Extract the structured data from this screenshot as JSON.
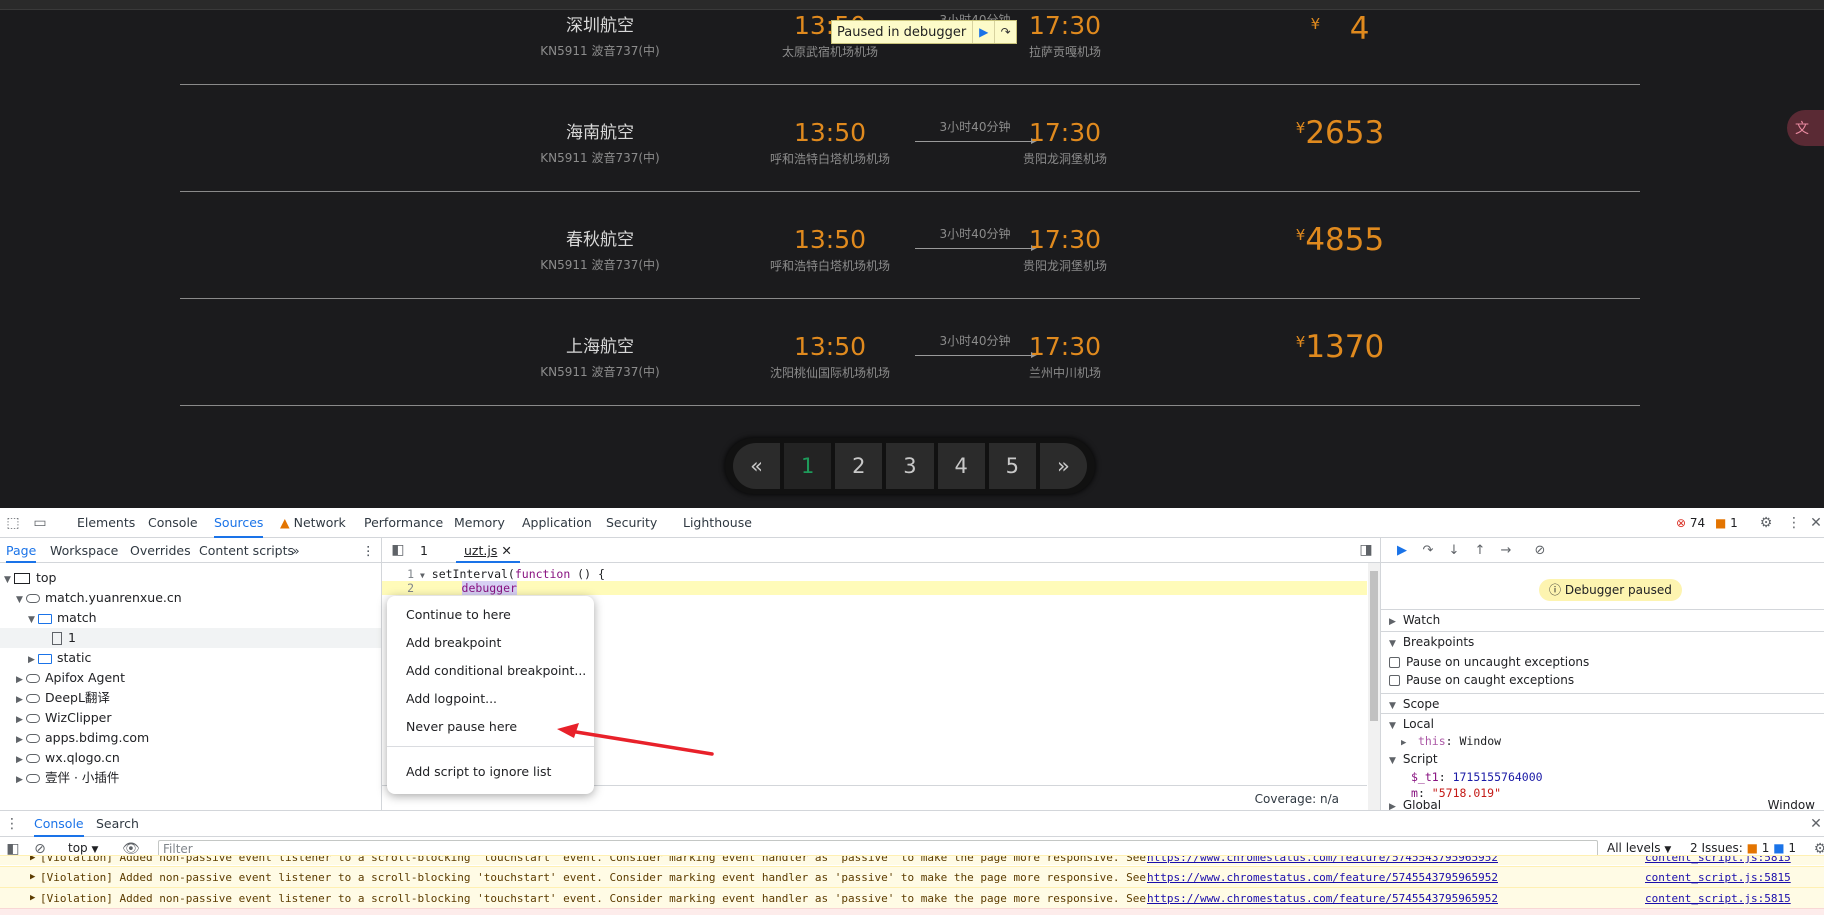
{
  "page": {
    "flights": [
      {
        "airline": "深圳航空",
        "plane": "KN5911 波音737(中)",
        "dep_time": "13:50",
        "dep_airport": "太原武宿机场机场",
        "duration": "3小时40分钟",
        "arr_time": "17:30",
        "arr_airport": "拉萨贡嘎机场",
        "currency": "¥",
        "price": "4"
      },
      {
        "airline": "海南航空",
        "plane": "KN5911 波音737(中)",
        "dep_time": "13:50",
        "dep_airport": "呼和浩特白塔机场机场",
        "duration": "3小时40分钟",
        "arr_time": "17:30",
        "arr_airport": "贵阳龙洞堡机场",
        "currency": "¥",
        "price": "2653"
      },
      {
        "airline": "春秋航空",
        "plane": "KN5911 波音737(中)",
        "dep_time": "13:50",
        "dep_airport": "呼和浩特白塔机场机场",
        "duration": "3小时40分钟",
        "arr_time": "17:30",
        "arr_airport": "贵阳龙洞堡机场",
        "currency": "¥",
        "price": "4855"
      },
      {
        "airline": "上海航空",
        "plane": "KN5911 波音737(中)",
        "dep_time": "13:50",
        "dep_airport": "沈阳桃仙国际机场机场",
        "duration": "3小时40分钟",
        "arr_time": "17:30",
        "arr_airport": "兰州中川机场",
        "currency": "¥",
        "price": "1370"
      }
    ],
    "paused_banner": "Paused in debugger",
    "pagination": {
      "prev": "«",
      "pages": [
        "1",
        "2",
        "3",
        "4",
        "5"
      ],
      "active": "1",
      "next": "»"
    },
    "colors": {
      "price": "#e08a1e",
      "active_page": "#1e9a5a",
      "background": "#1b1b1d"
    }
  },
  "devtools": {
    "tabs": [
      "Elements",
      "Console",
      "Sources",
      "Network",
      "Performance",
      "Memory",
      "Application",
      "Security",
      "Lighthouse"
    ],
    "active_tab": "Sources",
    "error_count": "74",
    "warning_count": "1",
    "navigator": {
      "tabs": [
        "Page",
        "Workspace",
        "Overrides",
        "Content scripts"
      ],
      "tree": {
        "top": "top",
        "domain": "match.yuanrenxue.cn",
        "folder_match": "match",
        "file_1": "1",
        "folder_static": "static",
        "extensions": [
          "Apifox Agent",
          "DeepL翻译",
          "WizClipper",
          "apps.bdimg.com",
          "wx.qlogo.cn",
          "壹伴 · 小插件"
        ]
      }
    },
    "editor": {
      "tab_1": "1",
      "tab_file": "uzt.js",
      "line1_num": "1",
      "line1_code": "setInterval(",
      "line1_kw": "function",
      "line1_rest": " () {",
      "line2_num": "2",
      "line2_code": "debugger",
      "coverage": "Coverage: n/a"
    },
    "context_menu": {
      "items": [
        "Continue to here",
        "Add breakpoint",
        "Add conditional breakpoint...",
        "Add logpoint...",
        "Never pause here"
      ],
      "last_item": "Add script to ignore list"
    },
    "sidebar": {
      "paused_label": "Debugger paused",
      "watch": "Watch",
      "breakpoints": "Breakpoints",
      "pause_uncaught": "Pause on uncaught exceptions",
      "pause_caught": "Pause on caught exceptions",
      "scope": "Scope",
      "local": "Local",
      "this_key": "this",
      "this_val": "Window",
      "script": "Script",
      "t1_key": "$_t1",
      "t1_val": "1715155764000",
      "m_key": "m",
      "m_val": "\"5718.019\"",
      "global": "Global",
      "global_val": "Window"
    },
    "drawer": {
      "tabs": [
        "Console",
        "Search"
      ],
      "context": "top",
      "filter_placeholder": "Filter",
      "levels": "All levels",
      "issues_label": "2 Issues:",
      "issues_warn": "1",
      "issues_info": "1",
      "warnings": [
        {
          "msg": "[Violation] Added non-passive event listener to a scroll-blocking 'touchstart' event. Consider marking event handler as 'passive' to make the page more responsive. See",
          "link": "https://www.chromestatus.com/feature/5745543795965952",
          "src": "content_script.js:5815"
        },
        {
          "msg": "[Violation] Added non-passive event listener to a scroll-blocking 'touchstart' event. Consider marking event handler as 'passive' to make the page more responsive. See",
          "link": "https://www.chromestatus.com/feature/5745543795965952",
          "src": "content_script.js:5815"
        },
        {
          "msg": "[Violation] Added non-passive event listener to a scroll-blocking 'touchstart' event. Consider marking event handler as 'passive' to make the page more responsive. See",
          "link": "https://www.chromestatus.com/feature/5745543795965952",
          "src": "content_script.js:5815"
        }
      ]
    }
  }
}
